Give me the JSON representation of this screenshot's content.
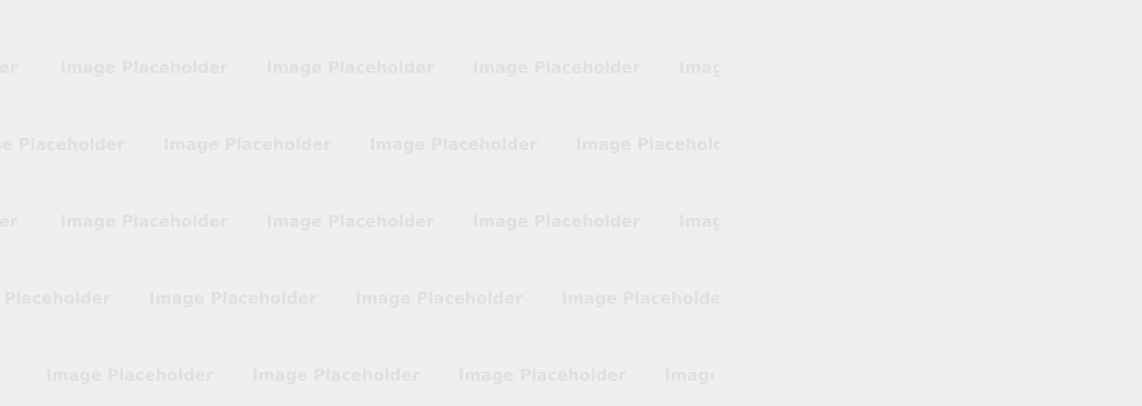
{
  "background": {
    "color": "#efefef",
    "text_color": "#dfe0e2"
  },
  "placeholder": {
    "label": "Image Placeholder",
    "row_1": [
      "Image Placeholder",
      "Image Placeholder",
      "Image Placeholder",
      "Image Placeholder"
    ],
    "row_2": [
      "Image Placeholder",
      "Image Placeholder",
      "Image Placeholder",
      "Image Placeholder"
    ],
    "row_3": [
      "Image Placeholder",
      "Image Placeholder",
      "Image Placeholder",
      "Image Placeholder"
    ],
    "row_4": [
      "Image Placeholder",
      "Image Placeholder",
      "Image Placeholder",
      "Image Placeholder"
    ],
    "row_5": [
      "Image Placeholder",
      "Image Placeholder",
      "Image Placeholder",
      "Image Placeholder"
    ]
  }
}
